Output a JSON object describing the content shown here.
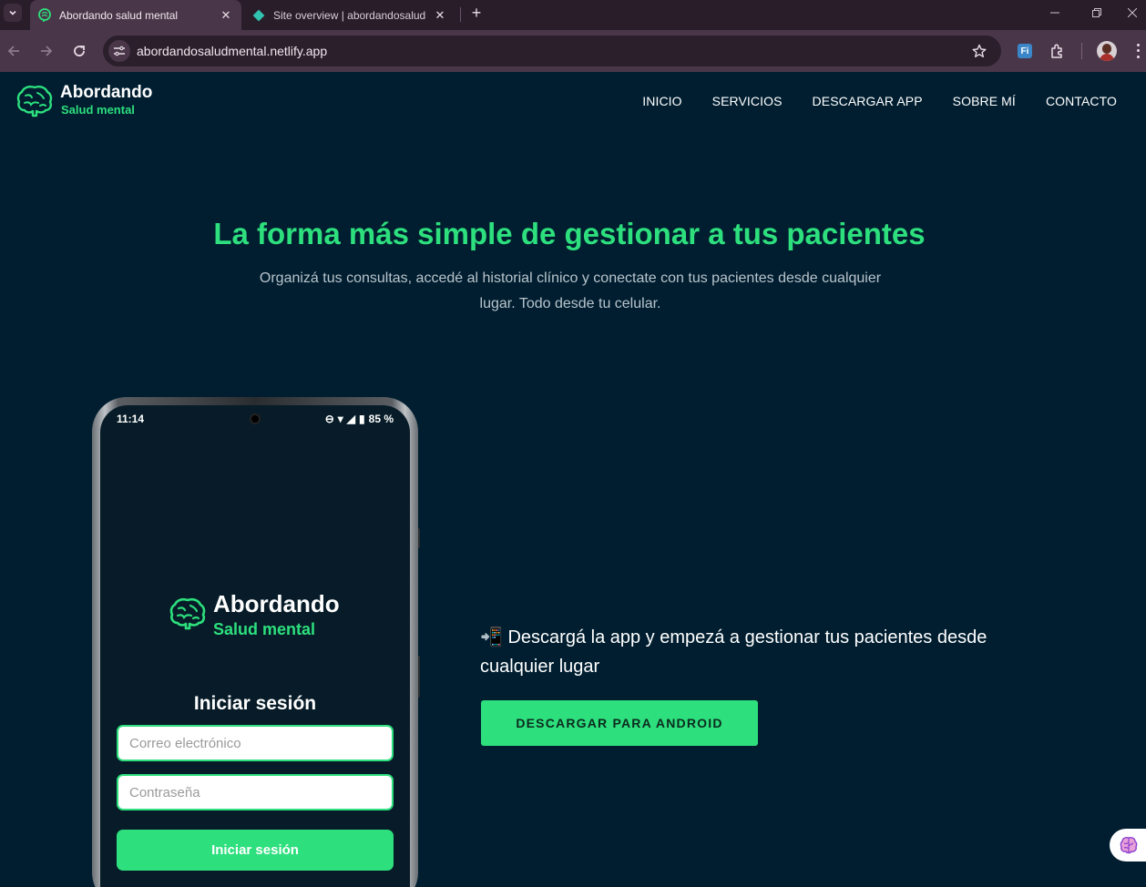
{
  "browser": {
    "tabs": [
      {
        "title": "Abordando salud mental",
        "active": true,
        "favicon": "brain-icon"
      },
      {
        "title": "Site overview | abordandosalud",
        "active": false,
        "favicon": "netlify-icon"
      }
    ],
    "url": "abordandosaludmental.netlify.app",
    "extension_label": "Fi"
  },
  "site": {
    "brand": {
      "name": "Abordando",
      "tagline": "Salud mental"
    },
    "nav": [
      "INICIO",
      "SERVICIOS",
      "DESCARGAR APP",
      "SOBRE MÍ",
      "CONTACTO"
    ],
    "hero": {
      "title": "La forma más simple de gestionar a tus pacientes",
      "subtitle": "Organizá tus consultas, accedé al historial clínico y conectate con tus pacientes desde cualquier lugar. Todo desde tu celular."
    },
    "phone": {
      "time": "11:14",
      "battery": "85 %",
      "app_name": "Abordando",
      "app_tagline": "Salud mental",
      "login_title": "Iniciar sesión",
      "email_placeholder": "Correo electrónico",
      "password_placeholder": "Contraseña",
      "login_button": "Iniciar sesión"
    },
    "download": {
      "icon": "📲",
      "text": "Descargá la app y empezá a gestionar tus pacientes desde cualquier lugar",
      "button": "DESCARGAR PARA ANDROID"
    }
  },
  "colors": {
    "background": "#001e30",
    "accent": "#2ddf7d",
    "browser_frame": "#4a3649"
  }
}
